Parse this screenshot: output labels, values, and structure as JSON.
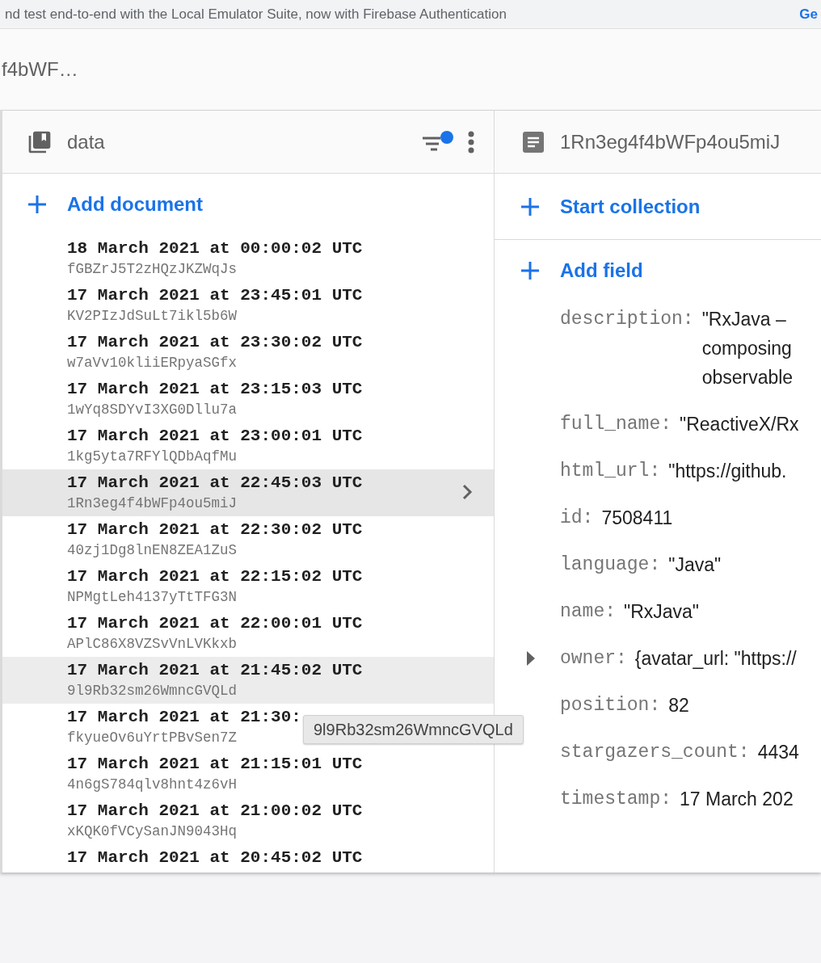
{
  "banner": {
    "text": "nd test end-to-end with the Local Emulator Suite, now with Firebase Authentication",
    "link": "Ge"
  },
  "breadcrumb": "f4bWF…",
  "collection": {
    "title": "data",
    "filter_active": true,
    "add_label": "Add document",
    "documents": [
      {
        "title": "18 March 2021 at 00:00:02 UTC",
        "id": "fGBZrJ5T2zHQzJKZWqJs",
        "selected": false,
        "hovered": false
      },
      {
        "title": "17 March 2021 at 23:45:01 UTC",
        "id": "KV2PIzJdSuLt7ikl5b6W",
        "selected": false,
        "hovered": false
      },
      {
        "title": "17 March 2021 at 23:30:02 UTC",
        "id": "w7aVv10kliiERpyaSGfx",
        "selected": false,
        "hovered": false
      },
      {
        "title": "17 March 2021 at 23:15:03 UTC",
        "id": "1wYq8SDYvI3XG0Dllu7a",
        "selected": false,
        "hovered": false
      },
      {
        "title": "17 March 2021 at 23:00:01 UTC",
        "id": "1kg5yta7RFYlQDbAqfMu",
        "selected": false,
        "hovered": false
      },
      {
        "title": "17 March 2021 at 22:45:03 UTC",
        "id": "1Rn3eg4f4bWFp4ou5miJ",
        "selected": true,
        "hovered": false
      },
      {
        "title": "17 March 2021 at 22:30:02 UTC",
        "id": "40zj1Dg8lnEN8ZEA1ZuS",
        "selected": false,
        "hovered": false
      },
      {
        "title": "17 March 2021 at 22:15:02 UTC",
        "id": "NPMgtLeh4137yTtTFG3N",
        "selected": false,
        "hovered": false
      },
      {
        "title": "17 March 2021 at 22:00:01 UTC",
        "id": "APlC86X8VZSvVnLVKkxb",
        "selected": false,
        "hovered": false
      },
      {
        "title": "17 March 2021 at 21:45:02 UTC",
        "id": "9l9Rb32sm26WmncGVQLd",
        "selected": false,
        "hovered": true
      },
      {
        "title": "17 March 2021 at 21:30:",
        "id": "fkyueOv6uYrtPBvSen7Z",
        "selected": false,
        "hovered": false
      },
      {
        "title": "17 March 2021 at 21:15:01 UTC",
        "id": "4n6gS784qlv8hnt4z6vH",
        "selected": false,
        "hovered": false
      },
      {
        "title": "17 March 2021 at 21:00:02 UTC",
        "id": "xKQK0fVCySanJN9043Hq",
        "selected": false,
        "hovered": false
      },
      {
        "title": "17 March 2021 at 20:45:02 UTC",
        "selected": false,
        "hovered": false
      }
    ]
  },
  "tooltip": "9l9Rb32sm26WmncGVQLd",
  "document": {
    "title": "1Rn3eg4f4bWFp4ou5miJ",
    "add_collection_label": "Start collection",
    "add_field_label": "Add field",
    "fields": [
      {
        "key": "description:",
        "lines": [
          "\"RxJava –",
          "composing",
          "observable"
        ]
      },
      {
        "key": "full_name:",
        "lines": [
          "\"ReactiveX/Rx"
        ]
      },
      {
        "key": "html_url:",
        "lines": [
          "\"https://github."
        ]
      },
      {
        "key": "id:",
        "lines": [
          "7508411"
        ]
      },
      {
        "key": "language:",
        "lines": [
          "\"Java\""
        ]
      },
      {
        "key": "name:",
        "lines": [
          "\"RxJava\""
        ]
      },
      {
        "key": "owner:",
        "lines": [
          "{avatar_url: \"https://"
        ],
        "expanded": false
      },
      {
        "key": "position:",
        "lines": [
          "82"
        ]
      },
      {
        "key": "stargazers_count:",
        "lines": [
          "4434"
        ]
      },
      {
        "key": "timestamp:",
        "lines": [
          "17 March 202"
        ]
      }
    ]
  }
}
